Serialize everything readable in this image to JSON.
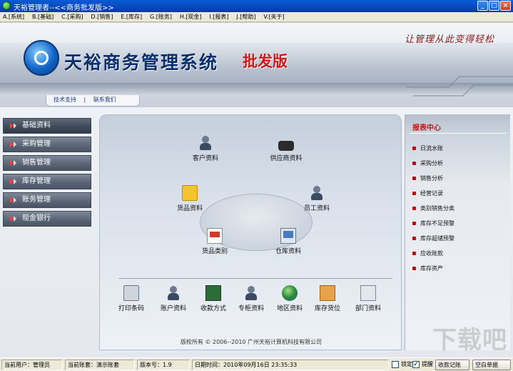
{
  "window": {
    "title": "天裕管理者--<<商务批发版>>",
    "minimize_glyph": "_",
    "maximize_glyph": "□",
    "close_glyph": "×"
  },
  "menu": {
    "items": [
      "A.[系统]",
      "B.[基础]",
      "C.[采购]",
      "D.[销售]",
      "E.[库存]",
      "G.[账务]",
      "H.[现金]",
      "I.[报表]",
      "J.[帮助]",
      "V.[关于]"
    ]
  },
  "banner": {
    "slogan": "让管理从此变得轻松",
    "brand_name": "天裕商务管理系统",
    "edition": "批发版",
    "links": [
      "技术支持",
      "联系我们"
    ],
    "link_separator": "|"
  },
  "left_nav": {
    "items": [
      {
        "label": "基础资料",
        "active": true
      },
      {
        "label": "采购管理",
        "active": false
      },
      {
        "label": "销售管理",
        "active": false
      },
      {
        "label": "库存管理",
        "active": false
      },
      {
        "label": "账务管理",
        "active": false
      },
      {
        "label": "现金银行",
        "active": false
      }
    ]
  },
  "center": {
    "main_icons": [
      {
        "label": "客户资料",
        "icon": "customer-icon"
      },
      {
        "label": "供应商资料",
        "icon": "supplier-icon"
      },
      {
        "label": "货品资料",
        "icon": "goods-icon"
      },
      {
        "label": "员工资料",
        "icon": "employee-icon"
      },
      {
        "label": "货品类别",
        "icon": "category-icon"
      },
      {
        "label": "仓库资料",
        "icon": "warehouse-icon"
      }
    ],
    "bottom_icons": [
      {
        "label": "打印条码",
        "icon": "printer-icon"
      },
      {
        "label": "账户资料",
        "icon": "account-icon"
      },
      {
        "label": "收款方式",
        "icon": "payment-icon"
      },
      {
        "label": "专柜资料",
        "icon": "counter-icon"
      },
      {
        "label": "地区资料",
        "icon": "region-icon"
      },
      {
        "label": "库存货位",
        "icon": "location-icon"
      },
      {
        "label": "部门资料",
        "icon": "department-icon"
      }
    ],
    "copyright": "版权所有 © 2006--2010 广州天裕计算机科技有限公司"
  },
  "report_center": {
    "title": "报表中心",
    "items": [
      "日流水账",
      "采购分析",
      "销售分析",
      "经营记录",
      "类别销售分类",
      "库存不足预警",
      "库存超储预警",
      "应收账款",
      "库存资产"
    ]
  },
  "watermark": "下载吧",
  "status_bar": {
    "current_user": "当前用户：管理员",
    "current_account": "当前账套：演示账套",
    "current_version": "版本号：1.9",
    "login_time": "日期时间：2010年09月16日  23:35:33",
    "check1": {
      "label": "锁定",
      "checked": false
    },
    "check2": {
      "label": "提醒",
      "checked": true
    },
    "button1": "收款记账",
    "button2": "空白单据"
  }
}
